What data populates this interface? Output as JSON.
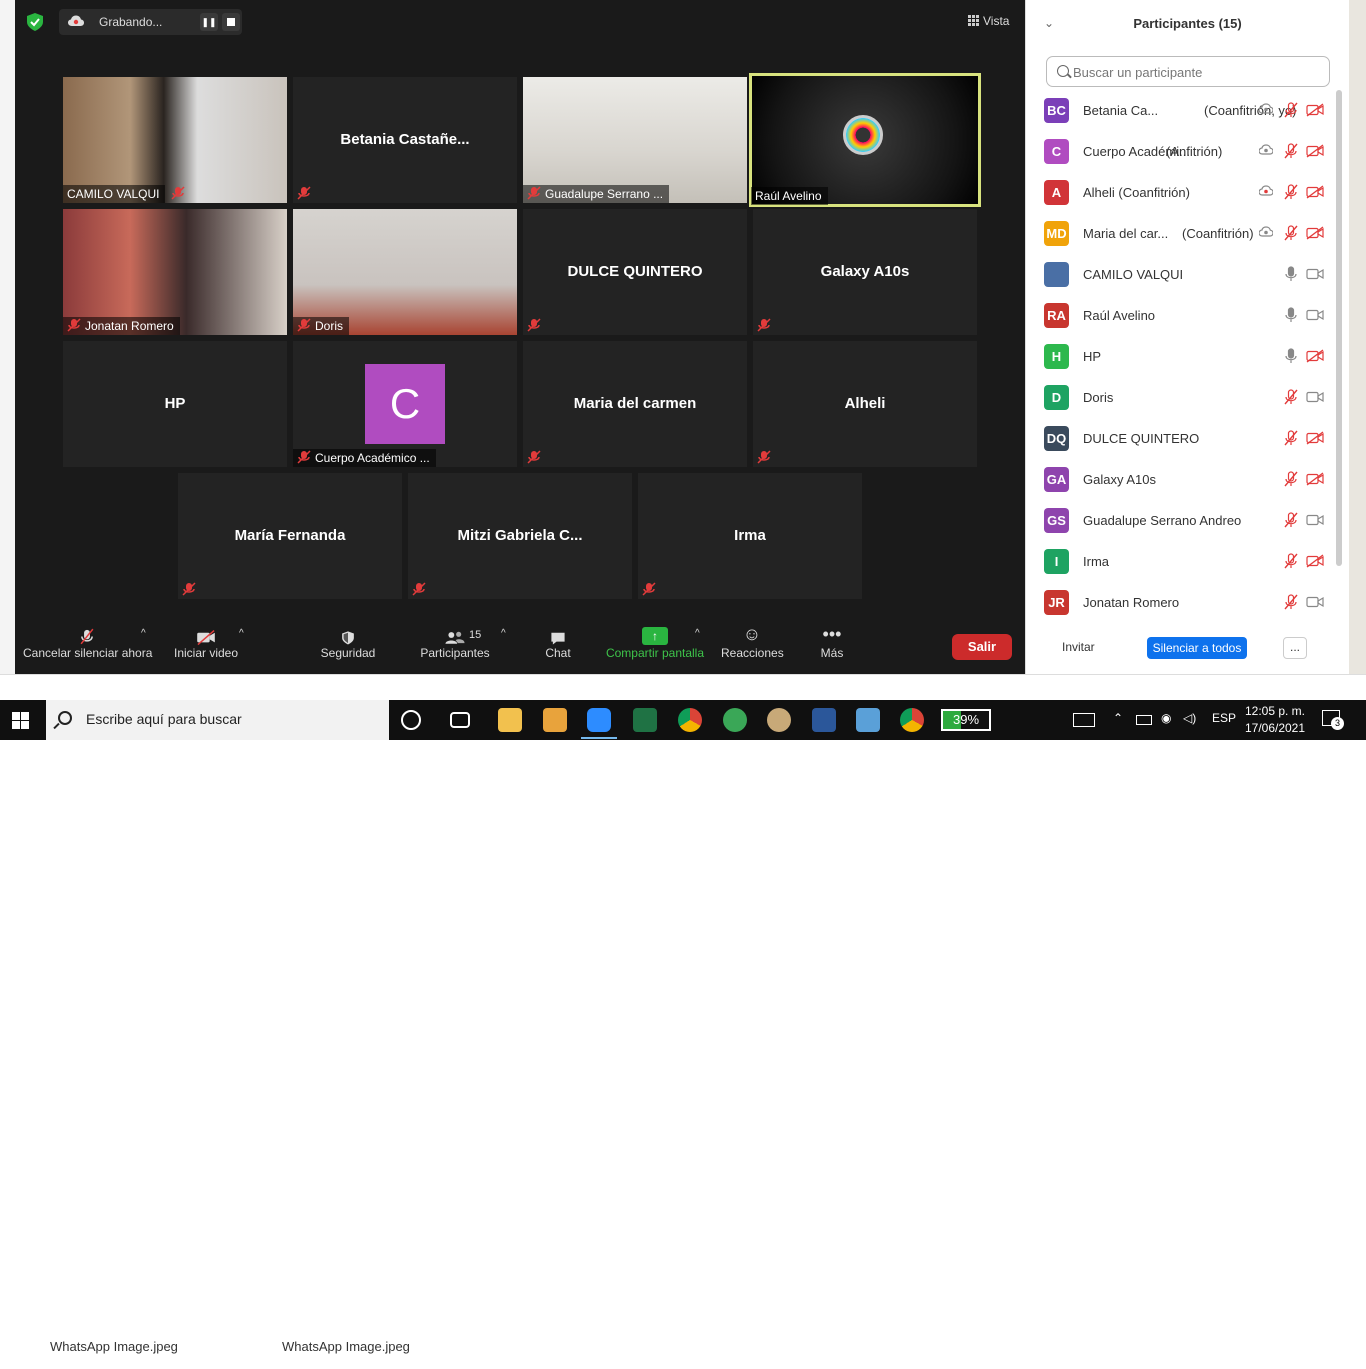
{
  "meeting": {
    "recording_label": "Grabando...",
    "view_label": "Vista",
    "tiles": [
      {
        "name": "CAMILO VALQUI",
        "kind": "video"
      },
      {
        "name": "Betania  Castañe...",
        "kind": "name"
      },
      {
        "name": "Guadalupe Serrano ...",
        "kind": "video"
      },
      {
        "name": "Raúl Avelino",
        "kind": "video"
      },
      {
        "name": "Jonatan Romero",
        "kind": "video"
      },
      {
        "name": "Doris",
        "kind": "video"
      },
      {
        "name": "DULCE QUINTERO",
        "kind": "name"
      },
      {
        "name": "Galaxy A10s",
        "kind": "name"
      },
      {
        "name": "HP",
        "kind": "name"
      },
      {
        "name": "Cuerpo Académico ...",
        "kind": "avatar",
        "avatar_letter": "C",
        "avatar_color": "#b04cc0"
      },
      {
        "name": "Maria del carmen",
        "kind": "name"
      },
      {
        "name": "Alheli",
        "kind": "name"
      },
      {
        "name": "María Fernanda",
        "kind": "name"
      },
      {
        "name": "Mitzi  Gabriela  C...",
        "kind": "name"
      },
      {
        "name": "Irma",
        "kind": "name"
      }
    ],
    "active_speaker_color": "#d8e37e"
  },
  "controls": {
    "mute_label": "Cancelar silenciar ahora",
    "video_label": "Iniciar video",
    "security_label": "Seguridad",
    "participants_label": "Participantes",
    "participants_count": "15",
    "chat_label": "Chat",
    "share_label": "Compartir pantalla",
    "reactions_label": "Reacciones",
    "more_label": "Más",
    "leave_label": "Salir"
  },
  "panel": {
    "title": "Participantes (15)",
    "search_placeholder": "Buscar un participante",
    "participants": [
      {
        "initials": "BC",
        "color": "#7b3fb8",
        "name": "Betania Ca...",
        "role": "(Coanfitrión, yo)",
        "mic": "muted",
        "cam": "off"
      },
      {
        "initials": "C",
        "color": "#b04cc0",
        "name": "Cuerpo Académi...",
        "role": "(Anfitrión)",
        "mic": "muted",
        "cam": "off"
      },
      {
        "initials": "A",
        "color": "#d13438",
        "name": "Alheli (Coanfitrión)",
        "role": "",
        "mic": "muted",
        "cam": "off"
      },
      {
        "initials": "MD",
        "color": "#f0a30a",
        "name": "Maria del car...",
        "role": "(Coanfitrión)",
        "mic": "muted",
        "cam": "off"
      },
      {
        "initials": "",
        "color": "#4a6fa5",
        "name": "CAMILO VALQUI",
        "role": "",
        "mic": "on",
        "cam": "on"
      },
      {
        "initials": "RA",
        "color": "#c8362f",
        "name": "Raúl Avelino",
        "role": "",
        "mic": "on",
        "cam": "on"
      },
      {
        "initials": "H",
        "color": "#2db84d",
        "name": "HP",
        "role": "",
        "mic": "on",
        "cam": "off"
      },
      {
        "initials": "D",
        "color": "#1ea362",
        "name": "Doris",
        "role": "",
        "mic": "muted",
        "cam": "on"
      },
      {
        "initials": "DQ",
        "color": "#3a4a5c",
        "name": "DULCE QUINTERO",
        "role": "",
        "mic": "muted",
        "cam": "off"
      },
      {
        "initials": "GA",
        "color": "#8e44ad",
        "name": "Galaxy A10s",
        "role": "",
        "mic": "muted",
        "cam": "off"
      },
      {
        "initials": "GS",
        "color": "#8e44ad",
        "name": "Guadalupe Serrano Andreo",
        "role": "",
        "mic": "muted",
        "cam": "on"
      },
      {
        "initials": "I",
        "color": "#1ea362",
        "name": "Irma",
        "role": "",
        "mic": "muted",
        "cam": "off"
      },
      {
        "initials": "JR",
        "color": "#c8362f",
        "name": "Jonatan Romero",
        "role": "",
        "mic": "muted",
        "cam": "on"
      }
    ],
    "invite_label": "Invitar",
    "mute_all_label": "Silenciar a todos",
    "more_label": "..."
  },
  "background": {
    "file1": "WhatsApp Image.jpeg",
    "file2": "WhatsApp Image.jpeg"
  },
  "taskbar": {
    "search_placeholder": "Escribe aquí para buscar",
    "battery": "39%",
    "language": "ESP",
    "time": "12:05 p. m.",
    "date": "17/06/2021",
    "notifications": "3"
  }
}
